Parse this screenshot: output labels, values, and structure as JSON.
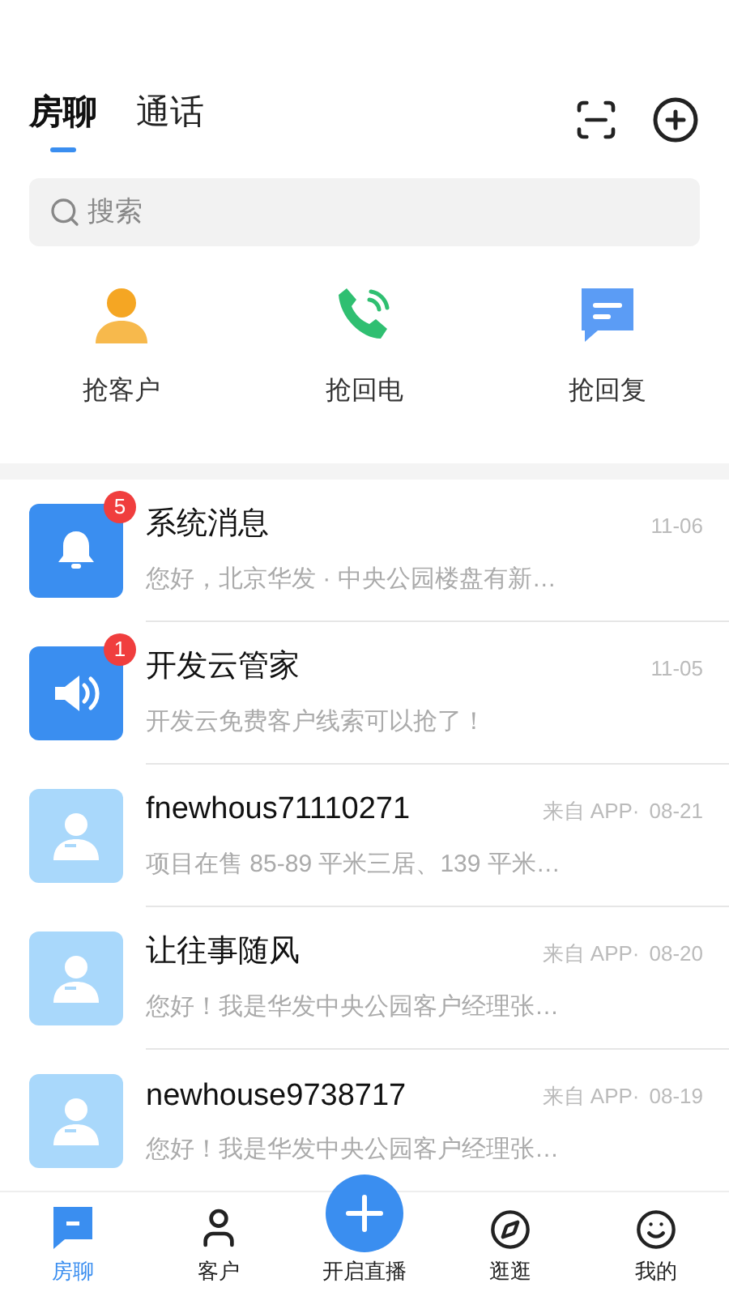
{
  "tabs": [
    {
      "label": "房聊",
      "selected": true
    },
    {
      "label": "通话",
      "selected": false
    }
  ],
  "search": {
    "placeholder": "搜索"
  },
  "actions": [
    {
      "kind": "customer",
      "label": "抢客户"
    },
    {
      "kind": "call",
      "label": "抢回电"
    },
    {
      "kind": "reply",
      "label": "抢回复"
    }
  ],
  "messages": [
    {
      "kind": "system",
      "name": "系统消息",
      "badge": "5",
      "date": "11-06",
      "preview": "您好，北京华发 · 中央公园楼盘有新…"
    },
    {
      "kind": "notice",
      "name": "开发云管家",
      "badge": "1",
      "date": "11-05",
      "preview": "开发云免费客户线索可以抢了！"
    },
    {
      "kind": "user",
      "name": "fnewhous71110271",
      "source": "来自 APP·",
      "date": "08-21",
      "preview": "项目在售 85-89 平米三居、139 平米…"
    },
    {
      "kind": "user",
      "name": "让往事随风",
      "source": "来自 APP·",
      "date": "08-20",
      "preview": "您好！我是华发中央公园客户经理张…"
    },
    {
      "kind": "user",
      "name": "newhouse9738717",
      "source": "来自 APP·",
      "date": "08-19",
      "preview": "您好！我是华发中央公园客户经理张…"
    }
  ],
  "nav": [
    {
      "kind": "chat",
      "label": "房聊",
      "selected": true
    },
    {
      "kind": "customer",
      "label": "客户",
      "selected": false
    },
    {
      "kind": "live",
      "label": "开启直播",
      "selected": false
    },
    {
      "kind": "explore",
      "label": "逛逛",
      "selected": false
    },
    {
      "kind": "me",
      "label": "我的",
      "selected": false
    }
  ]
}
